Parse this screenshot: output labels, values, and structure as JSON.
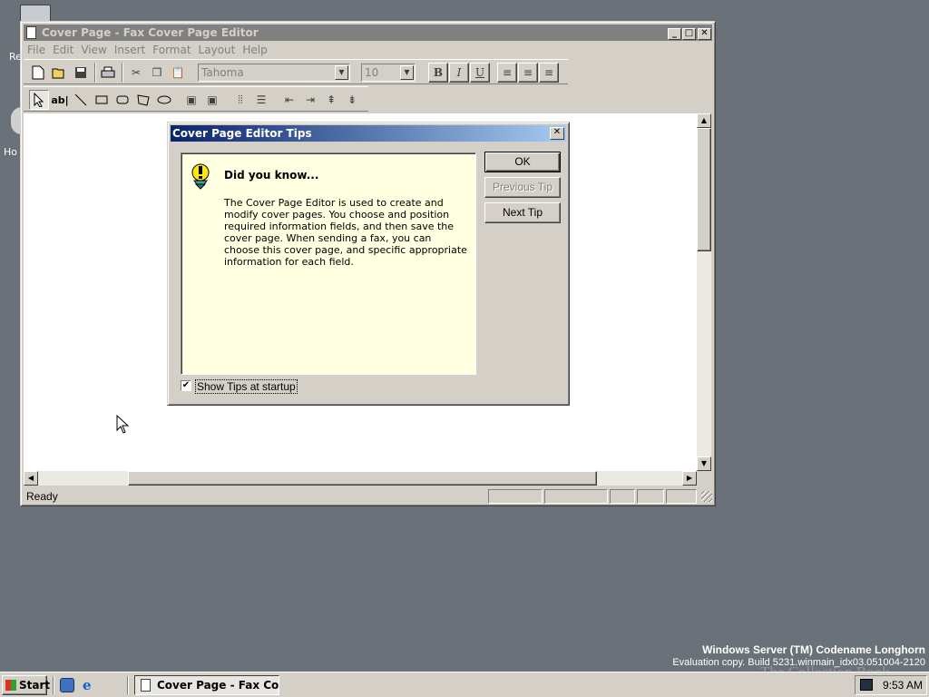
{
  "desktop": {
    "icon_label_1": "Re",
    "icon_label_2": "Ho"
  },
  "main_window": {
    "title": "Cover Page - Fax Cover Page Editor",
    "menu": [
      "File",
      "Edit",
      "View",
      "Insert",
      "Format",
      "Layout",
      "Help"
    ],
    "font_name": "Tahoma",
    "font_size": "10",
    "format_buttons": {
      "bold": "B",
      "italic": "I",
      "underline": "U"
    },
    "status_text": "Ready"
  },
  "dialog": {
    "title": "Cover Page Editor Tips",
    "heading": "Did you know...",
    "tip_text": "The Cover Page Editor is used to create and modify cover pages. You choose and position required information fields, and then save the cover page. When sending a fax, you can choose this cover page, and specific appropriate information for each field.",
    "ok_label": "OK",
    "previous_label": "Previous Tip",
    "next_label": "Next Tip",
    "checkbox_label": "Show Tips at startup",
    "checkbox_checked": true
  },
  "taskbar": {
    "start_label": "Start",
    "task_label": "Cover Page - Fax Co...",
    "clock": "9:53 AM"
  },
  "watermark": {
    "line1": "Windows Server (TM) Codename Longhorn",
    "line2": "Evaluation copy. Build 5231.winmain_idx03.051004-2120",
    "overlay": "The Collection Book"
  },
  "colors": {
    "desktop": "#6b7178",
    "face": "#d4d0c8",
    "title_active_start": "#0a246a",
    "title_active_end": "#a6caf0",
    "title_inactive": "#808080",
    "tip_background": "#ffffe1"
  }
}
